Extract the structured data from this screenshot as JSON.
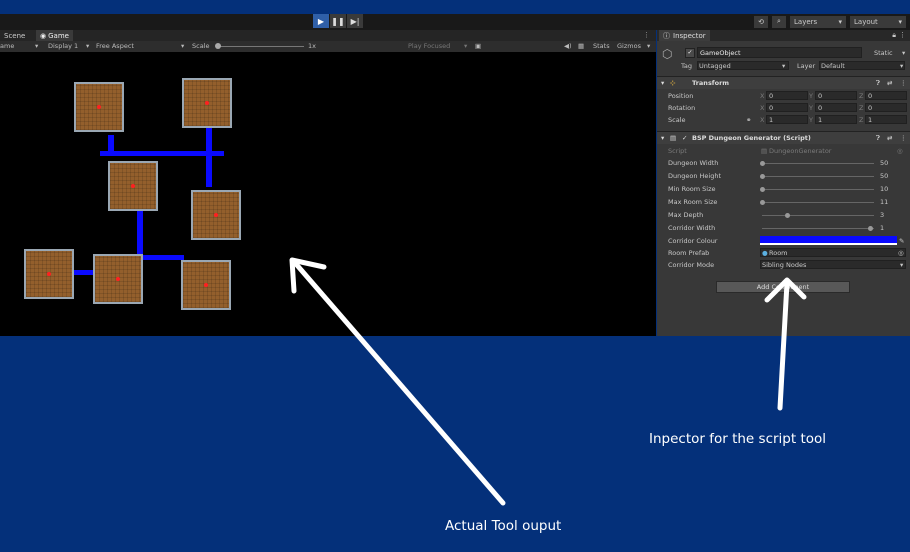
{
  "toolbar": {
    "play_icon": "play-icon",
    "pause_icon": "pause-icon",
    "step_icon": "step-icon",
    "history_icon": "history-icon",
    "search_icon": "search-icon",
    "layers_label": "Layers",
    "layout_label": "Layout"
  },
  "game_view": {
    "tabs": [
      {
        "label": "Scene"
      },
      {
        "label": "Game"
      }
    ],
    "display_mode": "ame",
    "display": "Display 1",
    "aspect": "Free Aspect",
    "scale_label": "Scale",
    "scale_value": "1x",
    "play_focused": "Play Focused",
    "stats": "Stats",
    "gizmos": "Gizmos"
  },
  "inspector": {
    "tab_label": "Inspector",
    "object_name": "GameObject",
    "static_label": "Static",
    "tag_label": "Tag",
    "tag_value": "Untagged",
    "layer_label": "Layer",
    "layer_value": "Default",
    "transform": {
      "title": "Transform",
      "rows": [
        {
          "label": "Position",
          "x": "0",
          "y": "0",
          "z": "0"
        },
        {
          "label": "Rotation",
          "x": "0",
          "y": "0",
          "z": "0"
        },
        {
          "label": "Scale",
          "x": "1",
          "y": "1",
          "z": "1"
        }
      ]
    },
    "script_component": {
      "title": "BSP Dungeon Generator (Script)",
      "script_label": "Script",
      "script_value": "DungeonGenerator",
      "sliders": [
        {
          "label": "Dungeon Width",
          "value": "50",
          "fraction": 0.0
        },
        {
          "label": "Dungeon Height",
          "value": "50",
          "fraction": 0.0
        },
        {
          "label": "Min Room Size",
          "value": "10",
          "fraction": 0.0
        },
        {
          "label": "Max Room Size",
          "value": "11",
          "fraction": 0.0
        },
        {
          "label": "Max Depth",
          "value": "3",
          "fraction": 0.22
        },
        {
          "label": "Corridor Width",
          "value": "1",
          "fraction": 0.96
        }
      ],
      "corridor_colour_label": "Corridor Colour",
      "corridor_colour": "#0a0aff",
      "room_prefab_label": "Room Prefab",
      "room_prefab_value": "Room",
      "corridor_mode_label": "Corridor Mode",
      "corridor_mode_value": "Sibling Nodes"
    },
    "add_component": "Add Component"
  },
  "captions": {
    "inspector_caption": "Inpector for the script tool",
    "output_caption": "Actual Tool ouput"
  }
}
